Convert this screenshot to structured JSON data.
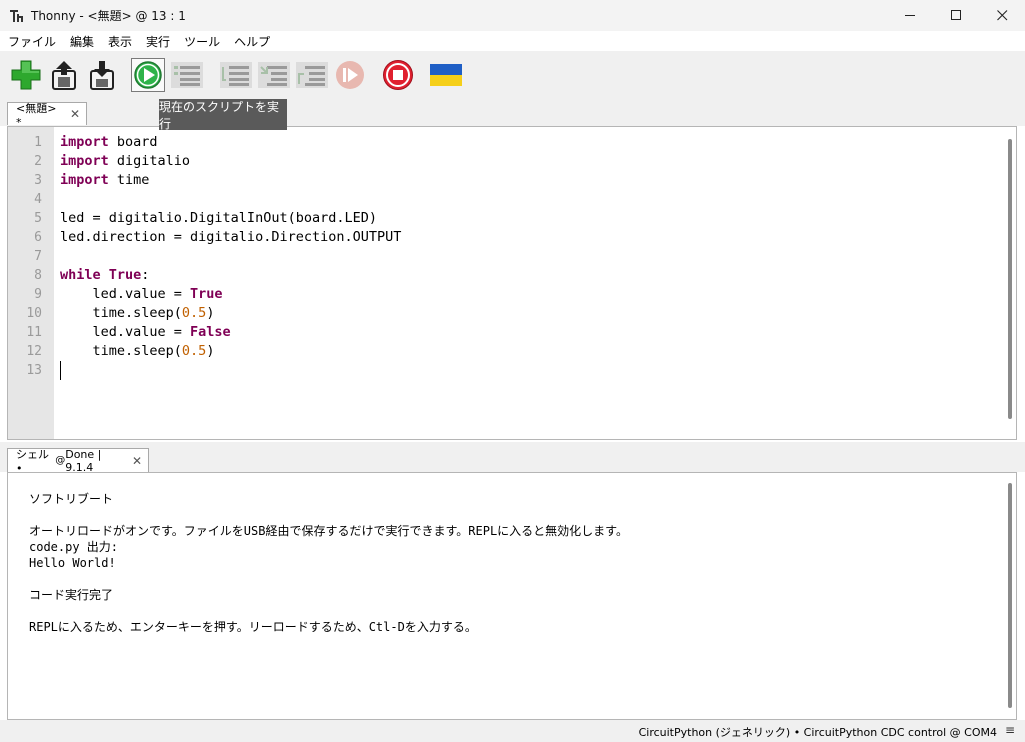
{
  "window": {
    "title": "Thonny  -  <無題>  @  13 : 1",
    "minimize_glyph": "—",
    "maximize_glyph": "☐",
    "close_glyph": "✕"
  },
  "menu": [
    "ファイル",
    "編集",
    "表示",
    "実行",
    "ツール",
    "ヘルプ"
  ],
  "toolbar": {
    "buttons": [
      {
        "name": "new-file",
        "icon": "plus-icon",
        "enabled": true
      },
      {
        "name": "open-file",
        "icon": "open-icon",
        "enabled": true
      },
      {
        "name": "save-file",
        "icon": "save-icon",
        "enabled": true
      },
      {
        "name": "run",
        "icon": "play-icon",
        "enabled": true,
        "active": true
      },
      {
        "name": "debug",
        "icon": "debug-icon",
        "enabled": false
      },
      {
        "name": "step-over",
        "icon": "step-over-icon",
        "enabled": false
      },
      {
        "name": "step-into",
        "icon": "step-into-icon",
        "enabled": false
      },
      {
        "name": "step-out",
        "icon": "step-out-icon",
        "enabled": false
      },
      {
        "name": "resume",
        "icon": "resume-icon",
        "enabled": false
      },
      {
        "name": "stop",
        "icon": "stop-icon",
        "enabled": true
      },
      {
        "name": "ukraine",
        "icon": "ukraine-flag-icon",
        "enabled": true
      }
    ],
    "tooltip": "現在のスクリプトを実行"
  },
  "editor": {
    "tab_label": "<無題> *",
    "line_numbers": [
      "1",
      "2",
      "3",
      "4",
      "5",
      "6",
      "7",
      "8",
      "9",
      "10",
      "11",
      "12",
      "13"
    ],
    "lines": [
      [
        {
          "t": "import",
          "c": "kw"
        },
        {
          "t": " board"
        }
      ],
      [
        {
          "t": "import",
          "c": "kw"
        },
        {
          "t": " digitalio"
        }
      ],
      [
        {
          "t": "import",
          "c": "kw"
        },
        {
          "t": " time"
        }
      ],
      [],
      [
        {
          "t": "led = digitalio.DigitalInOut(board.LED)"
        }
      ],
      [
        {
          "t": "led.direction = digitalio.Direction.OUTPUT"
        }
      ],
      [],
      [
        {
          "t": "while",
          "c": "kw"
        },
        {
          "t": " "
        },
        {
          "t": "True",
          "c": "kw"
        },
        {
          "t": ":"
        }
      ],
      [
        {
          "t": "    led.value = "
        },
        {
          "t": "True",
          "c": "kw"
        }
      ],
      [
        {
          "t": "    time.sleep("
        },
        {
          "t": "0.5",
          "c": "num"
        },
        {
          "t": ")"
        }
      ],
      [
        {
          "t": "    led.value = "
        },
        {
          "t": "False",
          "c": "kw"
        }
      ],
      [
        {
          "t": "    time.sleep("
        },
        {
          "t": "0.5",
          "c": "num"
        },
        {
          "t": ")"
        }
      ],
      []
    ]
  },
  "shell": {
    "tab_label": "シェル • ",
    "tab_status": "Done | 9.1.4",
    "lines": [
      "ソフトリブート",
      "",
      "オートリロードがオンです。ファイルをUSB経由で保存するだけで実行できます。REPLに入ると無効化します。",
      "code.py 出力:",
      "Hello World!",
      "",
      "コード実行完了",
      "",
      "REPLに入るため、エンターキーを押す。リーロードするため、Ctl-Dを入力する。"
    ]
  },
  "status": {
    "interpreter": "CircuitPython (ジェネリック)  •  CircuitPython CDC control @ COM4",
    "menu_glyph": "≡"
  },
  "colors": {
    "keyword": "#7f0055",
    "number": "#c06000",
    "run_green": "#2fb34a",
    "stop_red": "#e0202f"
  }
}
